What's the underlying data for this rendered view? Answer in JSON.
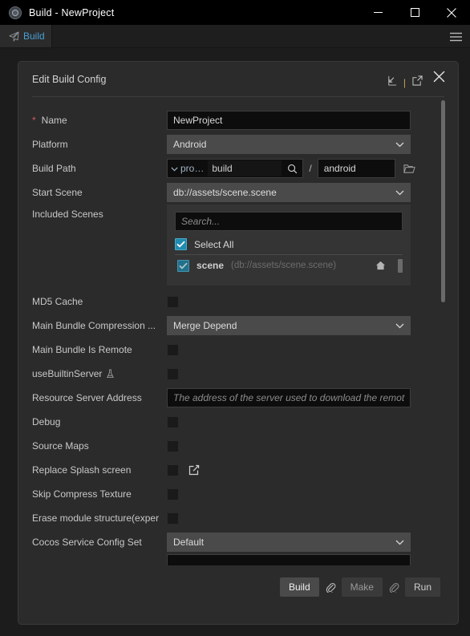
{
  "window": {
    "title": "Build - NewProject",
    "app_icon": "cocos-logo-icon",
    "minimize": "minimize-icon",
    "maximize": "maximize-icon",
    "close": "close-icon"
  },
  "tabbar": {
    "tab_label": "Build",
    "tab_icon": "paper-plane-icon",
    "menu_icon": "hamburger-menu-icon"
  },
  "dialog": {
    "title": "Edit Build Config",
    "import_icon": "import-arrow-icon",
    "divider": "|",
    "export_icon": "export-arrow-icon",
    "close_icon": "close-icon"
  },
  "form": {
    "name": {
      "label": "Name",
      "required_mark": "*",
      "value": "NewProject"
    },
    "platform": {
      "label": "Platform",
      "value": "Android"
    },
    "build_path": {
      "label": "Build Path",
      "project_token": "pro…",
      "folder_value": "build",
      "separator": "/",
      "sub_value": "android",
      "search_icon": "search-icon",
      "folder_icon": "folder-icon",
      "chevron_icon": "chevron-down-icon"
    },
    "start_scene": {
      "label": "Start Scene",
      "value": "db://assets/scene.scene"
    },
    "included_scenes": {
      "label": "Included Scenes",
      "search_placeholder": "Search...",
      "select_all_label": "Select All",
      "select_all_checked": true,
      "items": [
        {
          "name": "scene",
          "path": "(db://assets/scene.scene)",
          "checked": true,
          "home_icon": "home-icon"
        }
      ]
    },
    "md5_cache": {
      "label": "MD5 Cache",
      "checked": false
    },
    "main_bundle_compression": {
      "label": "Main Bundle Compression ...",
      "value": "Merge Depend"
    },
    "main_bundle_is_remote": {
      "label": "Main Bundle Is Remote",
      "checked": false
    },
    "use_builtin_server": {
      "label": "useBuiltinServer",
      "badge_icon": "experimental-flask-icon",
      "checked": false
    },
    "resource_server_address": {
      "label": "Resource Server Address",
      "placeholder": "The address of the server used to download the remot"
    },
    "debug": {
      "label": "Debug",
      "checked": false
    },
    "source_maps": {
      "label": "Source Maps",
      "checked": false
    },
    "replace_splash_screen": {
      "label": "Replace Splash screen",
      "checked": false,
      "edit_icon": "edit-square-icon"
    },
    "skip_compress_texture": {
      "label": "Skip Compress Texture",
      "checked": false
    },
    "erase_module_structure": {
      "label": "Erase module structure(exper",
      "checked": false
    },
    "cocos_service_config_set": {
      "label": "Cocos Service Config Set",
      "value": "Default"
    }
  },
  "footer": {
    "build_label": "Build",
    "link_icon_1": "paperclip-icon",
    "make_label": "Make",
    "link_icon_2": "paperclip-icon",
    "run_label": "Run"
  },
  "colors": {
    "accent_blue": "#4a9fd4",
    "checkbox_teal": "#1f8cb0",
    "required_red": "#d0585c",
    "dialog_bg": "#2b2b2b",
    "page_bg": "#1c1c1c",
    "input_bg": "#0d0d0d",
    "select_bg": "#4a4a4a"
  }
}
